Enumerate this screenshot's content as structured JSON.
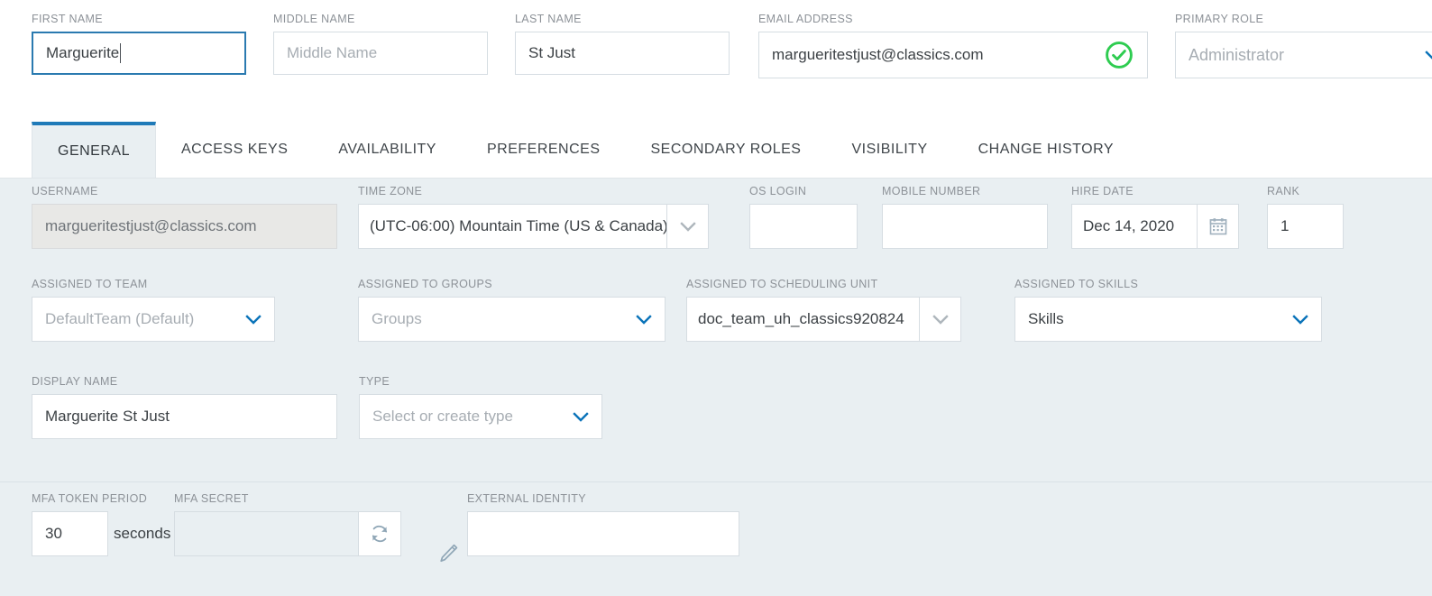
{
  "header": {
    "fields": [
      {
        "label": "FIRST NAME",
        "value": "Marguerite",
        "placeholder": "First Name",
        "focused": true
      },
      {
        "label": "MIDDLE NAME",
        "value": "",
        "placeholder": "Middle Name",
        "focused": false
      },
      {
        "label": "LAST NAME",
        "value": "St Just",
        "placeholder": "Last Name",
        "focused": false
      },
      {
        "label": "EMAIL ADDRESS",
        "value": "margueritestjust@classics.com",
        "placeholder": "Email Address",
        "focused": false
      },
      {
        "label": "PRIMARY ROLE",
        "value": "Administrator",
        "placeholder": "Primary Role",
        "focused": false
      }
    ],
    "email_valid_icon": "check-circle-icon",
    "role_chevron_icon": "chevron-down-icon"
  },
  "tabs": [
    {
      "label": "GENERAL",
      "active": true
    },
    {
      "label": "ACCESS KEYS",
      "active": false
    },
    {
      "label": "AVAILABILITY",
      "active": false
    },
    {
      "label": "PREFERENCES",
      "active": false
    },
    {
      "label": "SECONDARY ROLES",
      "active": false
    },
    {
      "label": "VISIBILITY",
      "active": false
    },
    {
      "label": "CHANGE HISTORY",
      "active": false
    }
  ],
  "general": {
    "username": {
      "label": "USERNAME",
      "value": "margueritestjust@classics.com"
    },
    "time_zone": {
      "label": "TIME ZONE",
      "value": "(UTC-06:00) Mountain Time (US & Canada)"
    },
    "os_login": {
      "label": "OS LOGIN",
      "value": ""
    },
    "mobile_number": {
      "label": "MOBILE NUMBER",
      "value": ""
    },
    "hire_date": {
      "label": "HIRE DATE",
      "value": "Dec 14, 2020",
      "icon": "calendar-icon"
    },
    "rank": {
      "label": "RANK",
      "value": "1"
    },
    "assigned_team": {
      "label": "ASSIGNED TO TEAM",
      "value": "DefaultTeam (Default)"
    },
    "assigned_groups": {
      "label": "ASSIGNED TO GROUPS",
      "value": "Groups"
    },
    "scheduling_unit": {
      "label": "ASSIGNED TO SCHEDULING UNIT",
      "value": "doc_team_uh_classics920824"
    },
    "assigned_skills": {
      "label": "ASSIGNED TO SKILLS",
      "value": "Skills"
    },
    "display_name": {
      "label": "DISPLAY NAME",
      "value": "Marguerite St Just"
    },
    "type": {
      "label": "TYPE",
      "value": "Select or create type"
    }
  },
  "mfa": {
    "token_period": {
      "label": "MFA TOKEN PERIOD",
      "value": "30",
      "unit": "seconds"
    },
    "secret": {
      "label": "MFA SECRET",
      "value": "",
      "refresh_icon": "refresh-icon"
    },
    "edit_icon": "pencil-icon",
    "external_identity": {
      "label": "EXTERNAL IDENTITY",
      "value": ""
    }
  },
  "colors": {
    "accent": "#1f7ab8",
    "panel_bg": "#e9eff2",
    "valid_green": "#2ecc50",
    "label_gray": "#8d9298"
  }
}
